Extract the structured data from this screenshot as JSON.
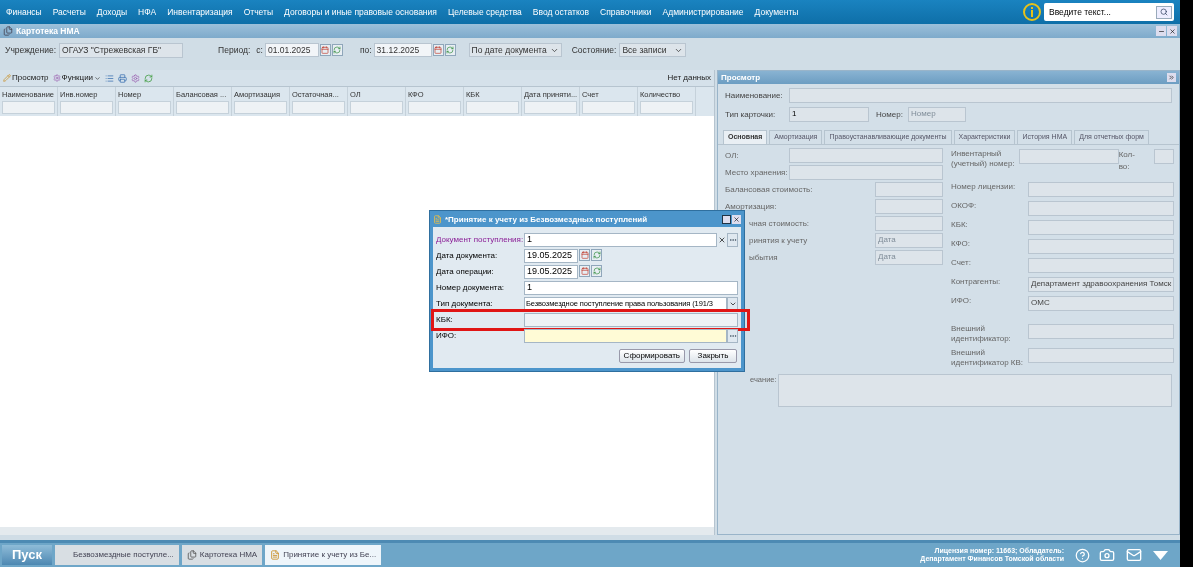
{
  "menu": [
    "Финансы",
    "Расчеты",
    "Доходы",
    "НФА",
    "Инвентаризация",
    "Отчеты",
    "Договоры и иные правовые основания",
    "Целевые средства",
    "Ввод остатков",
    "Справочники",
    "Администрирование",
    "Документы"
  ],
  "search": {
    "placeholder": "Введите текст..."
  },
  "window": {
    "title": "Картотека НМА"
  },
  "filters": {
    "institution_label": "Учреждение:",
    "institution": "ОГАУЗ \"Стрежевская ГБ\"",
    "period_label": "Период:",
    "from_label": "с:",
    "from": "01.01.2025",
    "to_label": "по:",
    "to": "31.12.2025",
    "date_mode": "По дате документа",
    "state_label": "Состояние:",
    "state": "Все записи"
  },
  "toolbar": {
    "view": "Просмотр",
    "functions": "Функции",
    "status": "Нет данных"
  },
  "table": {
    "columns": [
      "Наименование",
      "Инв.номер",
      "Номер",
      "Балансовая ...",
      "Амортизация",
      "Остаточная...",
      "ОЛ",
      "КФО",
      "КБК",
      "Дата приняти...",
      "Счет",
      "Количество"
    ]
  },
  "preview": {
    "title": "Просмотр",
    "name_label": "Наименование:",
    "card_type_label": "Тип карточки:",
    "card_type": "1",
    "number_label": "Номер:",
    "number_placeholder": "Номер",
    "tabs": [
      {
        "label": "Основная",
        "selected": true
      },
      {
        "label": "Амортизация",
        "selected": false
      },
      {
        "label": "Правоустанавливающие документы",
        "selected": false
      },
      {
        "label": "Характеристики",
        "selected": false
      },
      {
        "label": "История НМА",
        "selected": false
      },
      {
        "label": "Для отчетных форм",
        "selected": false
      }
    ],
    "left_fields": [
      {
        "label": "ОЛ:",
        "kind": "wide"
      },
      {
        "label": "Место хранения:",
        "kind": "wide"
      },
      {
        "label": "Балансовая стоимость:",
        "kind": "short"
      },
      {
        "label": "Амортизация:",
        "kind": "short"
      },
      {
        "label": "чная стоимость:",
        "kind": "covered"
      },
      {
        "label": "ринятия к учету",
        "kind": "covered",
        "placeholder": "Дата"
      },
      {
        "label": "ыбытия",
        "kind": "covered",
        "placeholder": "Дата"
      }
    ],
    "inventory_label": "Инвентарный (учетный) номер:",
    "quantity_label": "Кол-во:",
    "right_fields": [
      {
        "label": "Номер лицензии:"
      },
      {
        "label": "ОКОФ:"
      },
      {
        "label": "КБК:"
      },
      {
        "label": "КФО:"
      },
      {
        "label": "Счет:"
      },
      {
        "label": "Контрагенты:",
        "value": "Департамент здравоохранения Томск"
      },
      {
        "label": "ИФО:",
        "value": "ОМС"
      },
      {
        "label": "Внешний идентификатор:"
      },
      {
        "label": "Внешний идентификатор КВ:"
      }
    ],
    "note_label": "ечание:"
  },
  "dialog": {
    "title": "*Принятие к учету из Безвозмездных поступлений",
    "fields": [
      {
        "label": "Документ поступления:",
        "kind": "lookup",
        "value": "1",
        "emphasized": true,
        "invalid": false,
        "highlighted": false
      },
      {
        "label": "Дата документа:",
        "kind": "date",
        "value": "19.05.2025",
        "emphasized": false,
        "invalid": false,
        "highlighted": false
      },
      {
        "label": "Дата операции:",
        "kind": "date",
        "value": "19.05.2025",
        "emphasized": false,
        "invalid": false,
        "highlighted": false
      },
      {
        "label": "Номер документа:",
        "kind": "text",
        "value": "1",
        "emphasized": false,
        "invalid": false,
        "highlighted": false
      },
      {
        "label": "Тип документа:",
        "kind": "select",
        "value": "Безвозмездное поступление права пользования (191/3",
        "emphasized": false,
        "invalid": false,
        "highlighted": false
      },
      {
        "label": "КБК:",
        "kind": "text",
        "emphasized": false,
        "invalid": false,
        "highlighted": true
      },
      {
        "label": "ИФО:",
        "kind": "picker",
        "emphasized": false,
        "invalid": true,
        "highlighted": false
      }
    ],
    "buttons": [
      "Сформировать",
      "Закрыть"
    ]
  },
  "taskbar": {
    "start": "Пуск",
    "items": [
      {
        "label": "Безвозмездные поступле...",
        "selected": false,
        "kind": "plain"
      },
      {
        "label": "Картотека НМА",
        "selected": false,
        "kind": "card"
      },
      {
        "label": "Принятие к учету из Бе...",
        "selected": true,
        "kind": "form"
      }
    ],
    "license": [
      "Лицензия номер: 11663; Обладатель:",
      "Департамент Финансов Томской области"
    ]
  }
}
